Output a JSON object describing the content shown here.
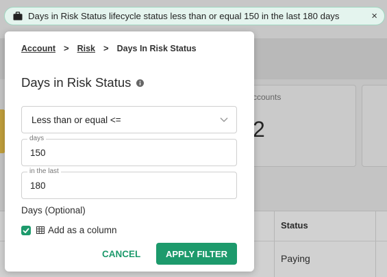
{
  "filter_chip": {
    "text": "Days in Risk Status lifecycle status less than or equal 150 in the last 180 days",
    "close_glyph": "×"
  },
  "background": {
    "card_label": "ccounts",
    "card_value": "2",
    "table_headers": [
      "Status"
    ],
    "table_cells": [
      "Paying"
    ]
  },
  "panel": {
    "breadcrumb": [
      "Account",
      "Risk",
      "Days In Risk Status"
    ],
    "breadcrumb_separator": ">",
    "title": "Days in Risk Status",
    "operator_select": {
      "value": "Less than or equal <="
    },
    "days_field": {
      "label": "days",
      "value": "150"
    },
    "in_the_last_field": {
      "label": "in the last",
      "value": "180"
    },
    "optional_label": "Days (Optional)",
    "add_column": {
      "label": "Add as a column",
      "checked": true
    },
    "cancel_label": "CANCEL",
    "apply_label": "APPLY FILTER"
  },
  "colors": {
    "accent": "#1d9a6c",
    "chip_bg": "#e4f4ee",
    "chip_border": "#9fd6c0"
  },
  "icons": {
    "chip": "briefcase-icon",
    "info": "info-icon",
    "select": "chevron-down-icon",
    "checkbox": "check-icon",
    "column": "table-icon"
  }
}
